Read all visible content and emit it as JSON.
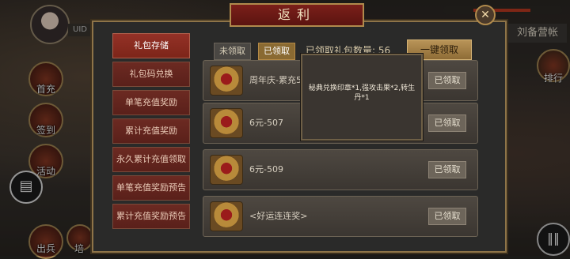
{
  "hud_left": {
    "uid_label": "UID",
    "buttons": [
      {
        "label": "首充",
        "icon": "first-recharge-icon"
      },
      {
        "label": "签到",
        "icon": "sign-in-icon"
      },
      {
        "label": "活动",
        "icon": "activity-icon"
      },
      {
        "label": "出兵",
        "icon": "dispatch-icon"
      },
      {
        "label": "培",
        "icon": "train-icon"
      }
    ]
  },
  "hud_right": {
    "camp_title": "刘备营帐",
    "rank_label": "排行"
  },
  "panel": {
    "title": "返利",
    "menu": [
      {
        "label": "礼包存储",
        "active": true
      },
      {
        "label": "礼包码兑换",
        "active": false
      },
      {
        "label": "单笔充值奖励",
        "active": false
      },
      {
        "label": "累计充值奖励",
        "active": false
      },
      {
        "label": "永久累计充值领取",
        "active": false
      },
      {
        "label": "单笔充值奖励预告",
        "active": false
      },
      {
        "label": "累计充值奖励预告",
        "active": false
      }
    ],
    "filters": {
      "unclaimed": "未领取",
      "claimed": "已领取"
    },
    "claimed_count_label": "已领取礼包数量: 56",
    "claim_all_label": "一键领取",
    "rows": [
      {
        "name": "周年庆-累充5",
        "status": "已领取"
      },
      {
        "name": "6元-507",
        "status": "已领取"
      },
      {
        "name": "6元-509",
        "status": "已领取"
      },
      {
        "name": "<好运连连奖>",
        "status": "已领取"
      }
    ]
  },
  "popup": {
    "text": "秘典兑换印章*1,强攻击果*2,转生丹*1"
  },
  "colors": {
    "menu_active": "#943127",
    "menu_idle": "#6c2a22",
    "gold_border": "#b08a4c",
    "claim_all": "#b99458"
  }
}
